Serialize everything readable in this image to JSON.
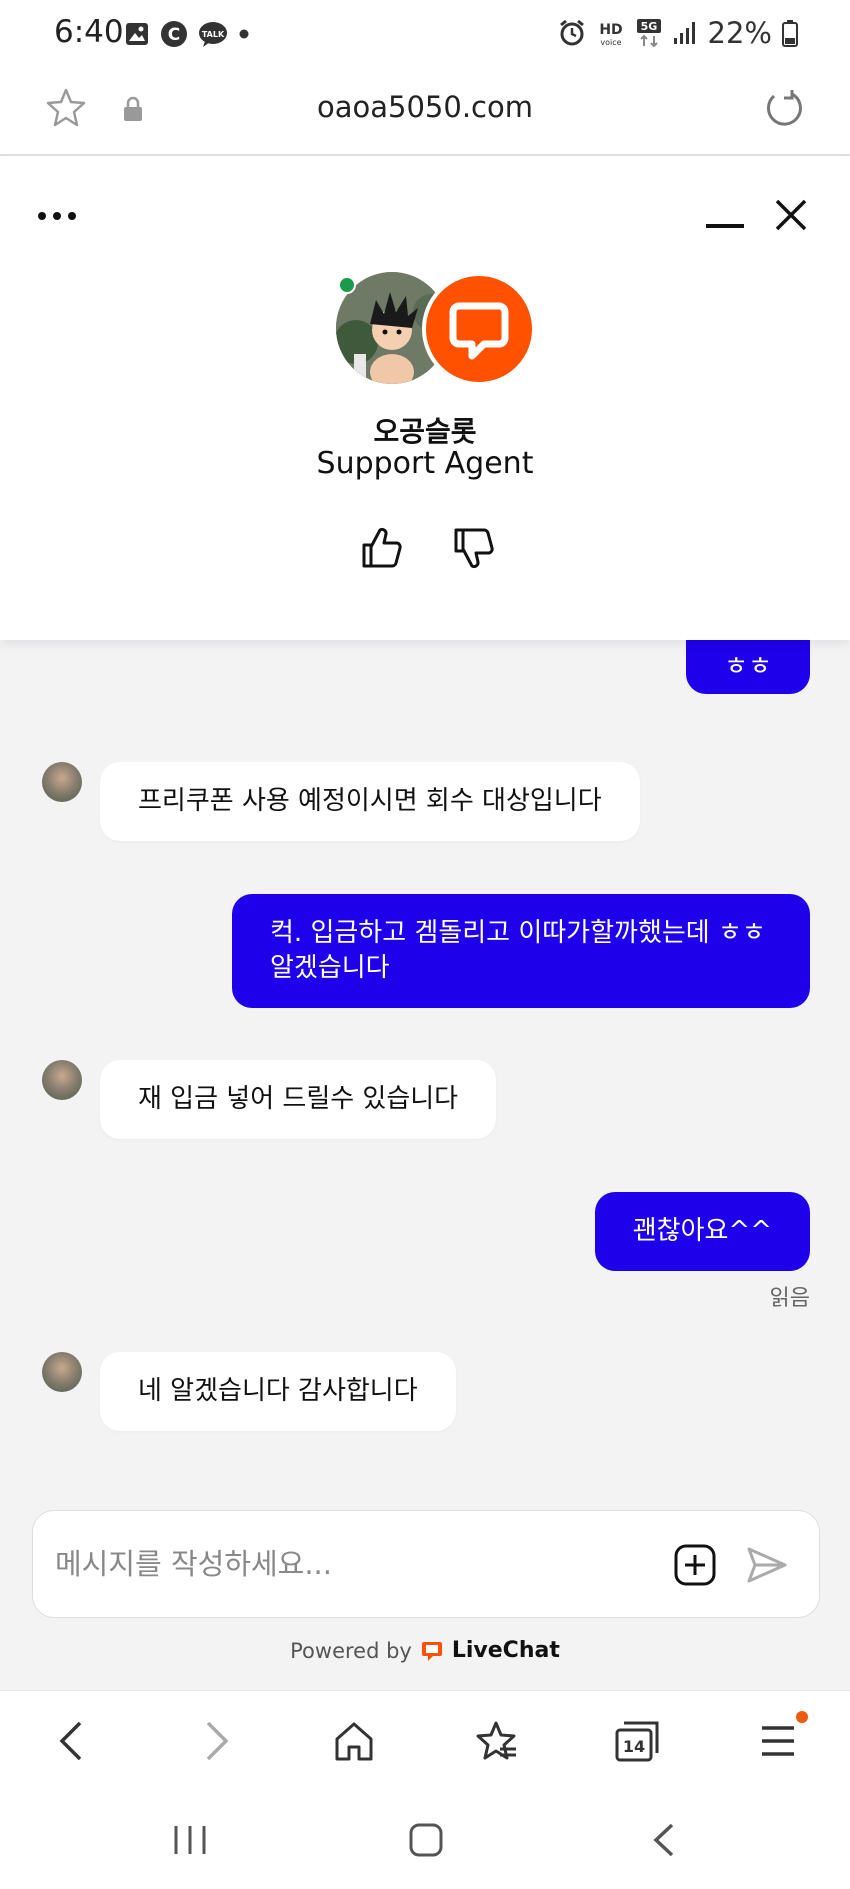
{
  "status_bar": {
    "time": "6:40",
    "battery": "22%",
    "icons": [
      "gallery-icon",
      "c-icon",
      "talk-icon",
      "dot-icon",
      "alarm-icon",
      "hd-voice-icon",
      "5g-icon",
      "signal-icon",
      "battery-icon"
    ]
  },
  "browser": {
    "url": "oaoa5050.com",
    "tab_count": "14"
  },
  "chat_header": {
    "agent_name": "오공슬롯",
    "agent_role": "Support Agent"
  },
  "messages": [
    {
      "from": "user",
      "text": "ㅎㅎ"
    },
    {
      "from": "agent",
      "text": "프리쿠폰 사용 예정이시면 회수 대상입니다"
    },
    {
      "from": "user",
      "text": "컥. 입금하고 겜돌리고 이따가할까했는데 ㅎㅎ 알겠습니다"
    },
    {
      "from": "agent",
      "text": "재 입금 넣어 드릴수 있습니다"
    },
    {
      "from": "user",
      "text": "괜찮아요^^"
    },
    {
      "from": "agent",
      "text": "네 알겠습니다 감사합니다"
    }
  ],
  "read_receipt": "읽음",
  "composer": {
    "placeholder": "메시지를 작성하세요..."
  },
  "footer": {
    "powered_by": "Powered by",
    "brand": "LiveChat"
  },
  "colors": {
    "user_bubble": "#1f00ea",
    "livechat_orange": "#ff5100",
    "chat_bg": "#f3f3f4"
  }
}
